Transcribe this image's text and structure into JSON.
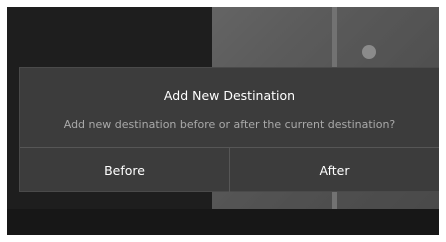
{
  "dialog": {
    "title": "Add New Destination",
    "message": "Add new destination before or after the current destination?",
    "before_label": "Before",
    "after_label": "After"
  },
  "colors": {
    "dialog_bg": "#3c3c3c",
    "screen_bg": "#2f2f2f",
    "text_primary": "#ffffff",
    "text_secondary": "#a9a9a9"
  }
}
